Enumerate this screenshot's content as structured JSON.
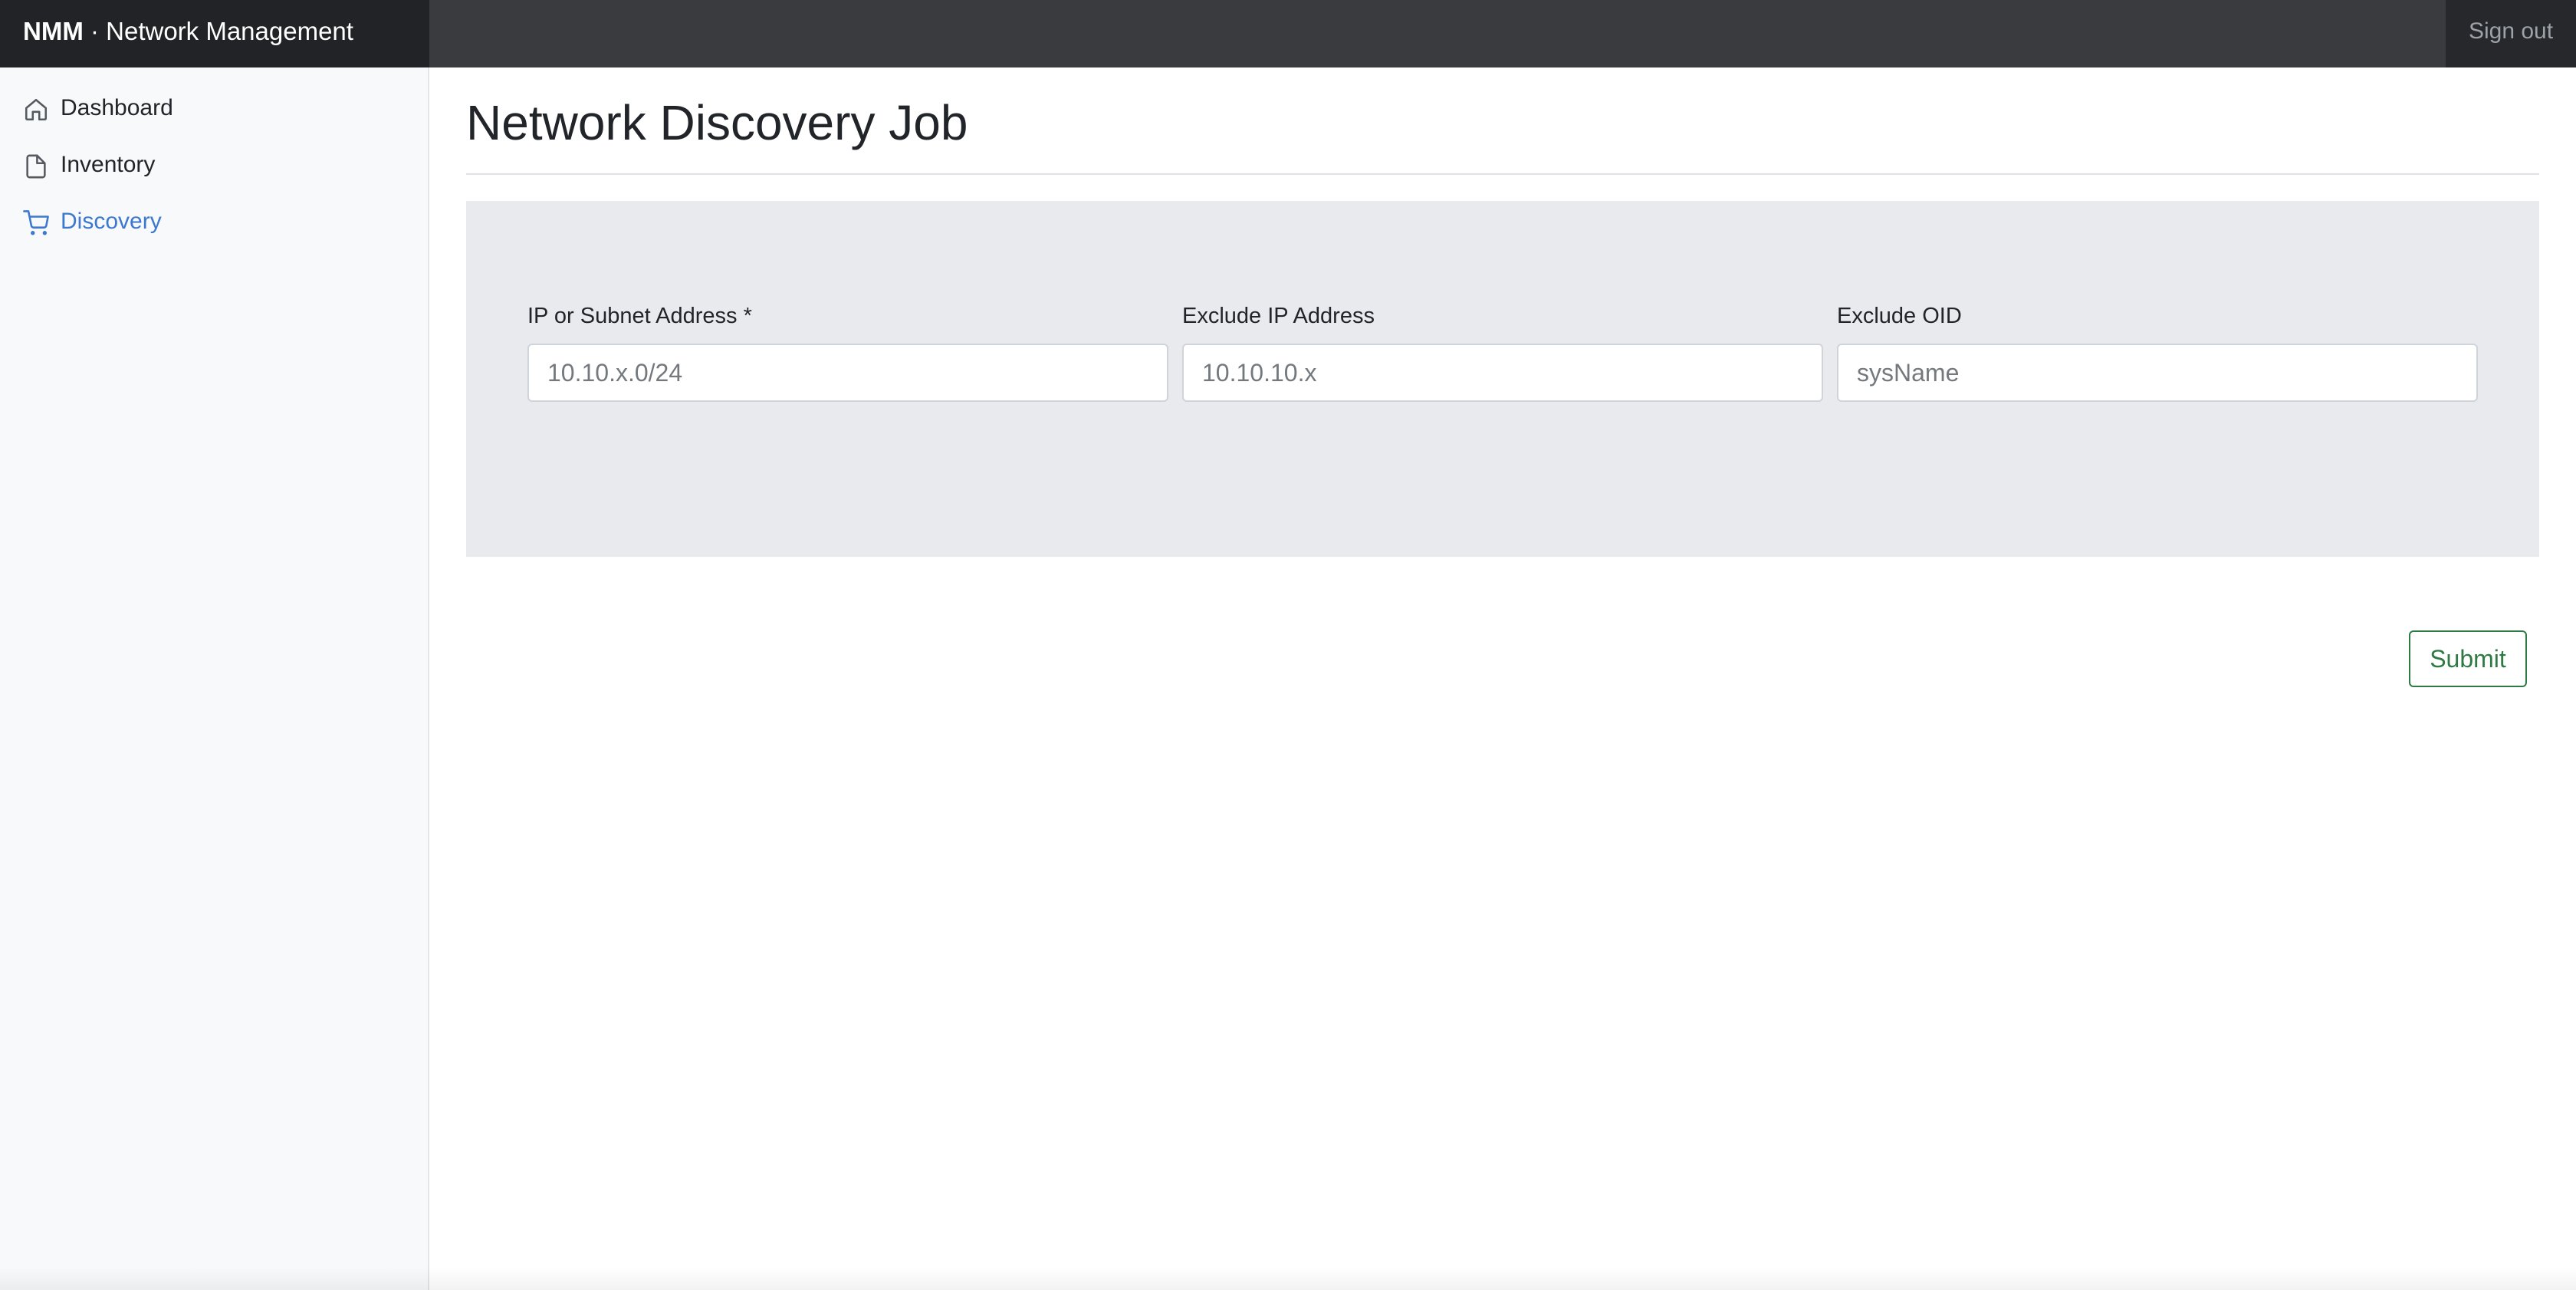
{
  "header": {
    "brand_bold": "NMM",
    "brand_separator": " · ",
    "brand_rest": "Network Management",
    "sign_out_label": "Sign out"
  },
  "sidebar": {
    "items": [
      {
        "label": "Dashboard",
        "icon": "home-icon",
        "active": false
      },
      {
        "label": "Inventory",
        "icon": "file-icon",
        "active": false
      },
      {
        "label": "Discovery",
        "icon": "shopping-cart-icon",
        "active": true
      }
    ]
  },
  "main": {
    "title": "Network Discovery Job",
    "form": {
      "fields": [
        {
          "label": "IP or Subnet Address *",
          "placeholder": "10.10.x.0/24",
          "value": ""
        },
        {
          "label": "Exclude IP Address",
          "placeholder": "10.10.10.x",
          "value": ""
        },
        {
          "label": "Exclude OID",
          "placeholder": "sysName",
          "value": ""
        }
      ],
      "submit_label": "Submit"
    }
  },
  "colors": {
    "topbar": "#3a3b3f",
    "brand_bg": "#212327",
    "sidebar_bg": "#f8f9fa",
    "active_nav": "#3c78cf",
    "form_panel": "#e9eaed",
    "submit_accent": "#2f7a44"
  }
}
